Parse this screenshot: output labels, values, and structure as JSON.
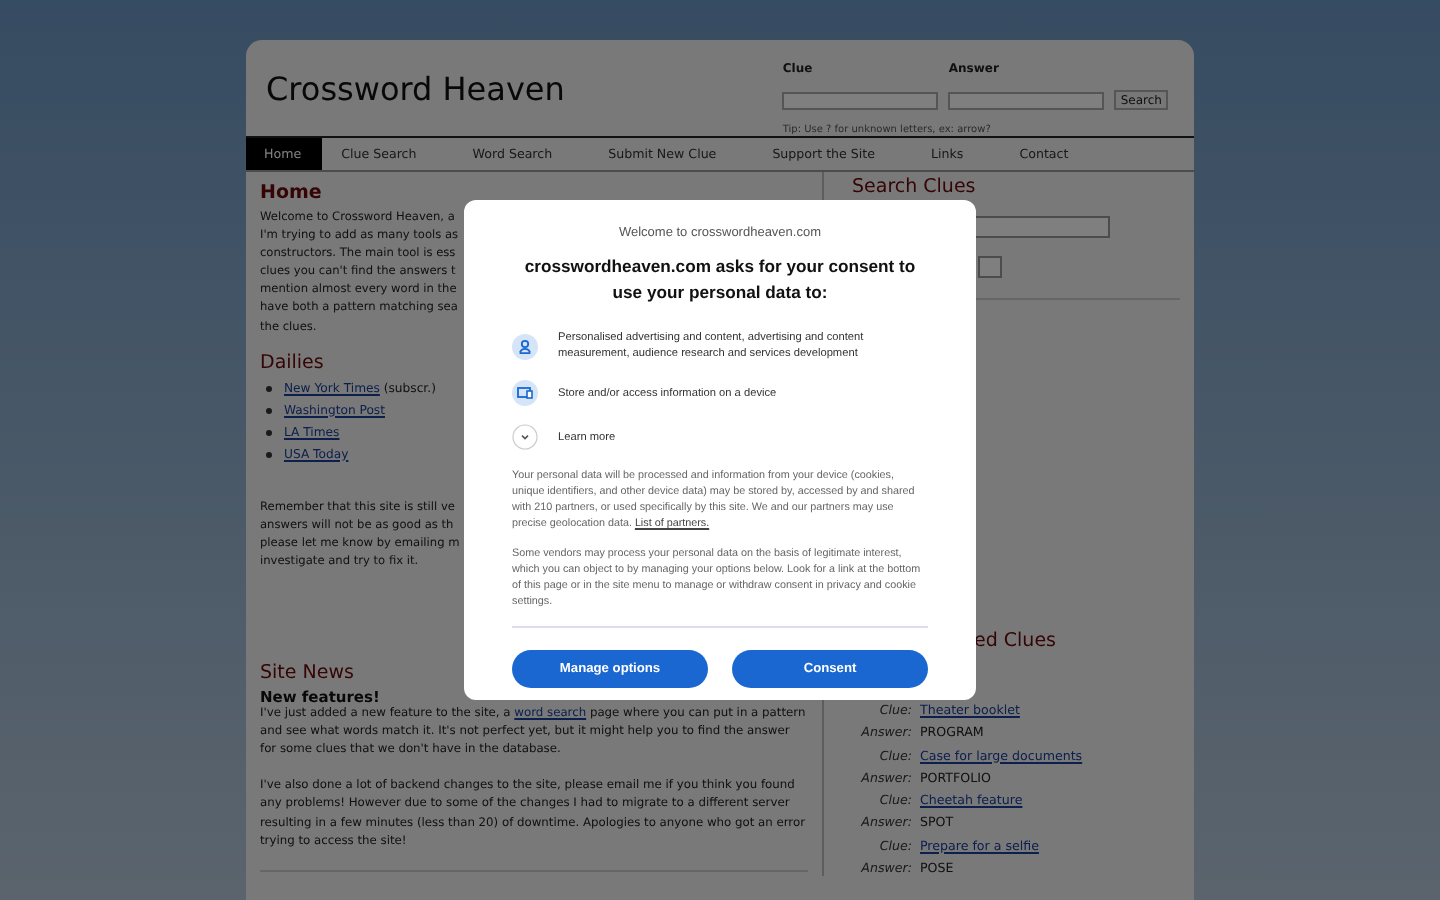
{
  "header": {
    "title": "Crossword Heaven",
    "clue_label": "Clue",
    "answer_label": "Answer",
    "button": "Search",
    "tip": "Tip: Use ? for unknown letters, ex: arrow?"
  },
  "nav": [
    {
      "label": "Home",
      "selected": true
    },
    {
      "label": "Clue Search",
      "selected": false
    },
    {
      "label": "Word Search",
      "selected": false
    },
    {
      "label": "Submit New Clue",
      "selected": false
    },
    {
      "label": "Support the Site",
      "selected": false
    },
    {
      "label": "Links",
      "selected": false
    },
    {
      "label": "Contact",
      "selected": false
    }
  ],
  "main": {
    "heading": "Home",
    "intro_lines": [
      "Welcome to Crossword Heaven, a",
      "I'm trying to add as many tools as",
      "constructors. The main tool is ess",
      "clues you can't find the answers t",
      "mention almost every word in the",
      "have both a pattern matching sea",
      "the clues."
    ],
    "dailies_heading": "Dailies",
    "dailies": [
      {
        "link": "New York Times",
        "note": "(subscr.)"
      },
      {
        "link": "Washington Post"
      },
      {
        "link": "LA Times"
      },
      {
        "link": "USA Today"
      }
    ],
    "remember_lines": [
      "Remember that this site is still ve",
      "answers will not be as good as th",
      "please let me know by emailing m",
      "investigate and try to fix it."
    ],
    "news_heading": "Site News",
    "news_title": "New features!",
    "news": [
      {
        "before": "I've just added a new feature to the site, a ",
        "link": "word search",
        "after": " page where you can put in a pattern and see what words match it. It's not perfect yet, but it might help you to find the answer for some clues that we don't have in the database."
      },
      {
        "before": "I've also done a lot of backend changes to the site, please email me if you think you found any problems! However due to some of the changes I had to migrate to a different server resulting in a few minutes (less than 20) of downtime. Apologies to anyone who got an error trying to access the site!"
      }
    ]
  },
  "sidebar": {
    "search_heading": "Search Clues",
    "recent_heading": "ed Clues",
    "recent": [
      {
        "label": "Clue:",
        "value": "Theater booklet",
        "kind": "link"
      },
      {
        "label": "Answer:",
        "value": "PROGRAM",
        "kind": "text"
      },
      {
        "label": "Clue:",
        "value": "Case for large documents",
        "kind": "link"
      },
      {
        "label": "Answer:",
        "value": "PORTFOLIO",
        "kind": "text"
      },
      {
        "label": "Clue:",
        "value": "Cheetah feature",
        "kind": "link"
      },
      {
        "label": "Answer:",
        "value": "SPOT",
        "kind": "text"
      },
      {
        "label": "Clue:",
        "value": "Prepare for a selfie",
        "kind": "link"
      },
      {
        "label": "Answer:",
        "value": "POSE",
        "kind": "text"
      }
    ]
  },
  "consent": {
    "welcome": "Welcome to crosswordheaven.com",
    "title": "crosswordheaven.com asks for your consent to use your personal data to:",
    "purposes": [
      {
        "kind": "person",
        "text": "Personalised advertising and content, advertising and content measurement, audience research and services development"
      },
      {
        "kind": "device",
        "text": "Store and/or access information on a device"
      }
    ],
    "learn_more": "Learn more",
    "paragraph_1": {
      "before": "Your personal data will be processed and information from your device (cookies, unique identifiers, and other device data) may be stored by, accessed by and shared with 210 partners, or used specifically by this site. We and our partners may use precise geolocation data. ",
      "link": "List of partners."
    },
    "paragraph_2": "Some vendors may process your personal data on the basis of legitimate interest, which you can object to by managing your options below. Look for a link at the bottom of this page or in the site menu to manage or withdraw consent in privacy and cookie settings.",
    "buttons": [
      "Manage options",
      "Consent"
    ]
  }
}
